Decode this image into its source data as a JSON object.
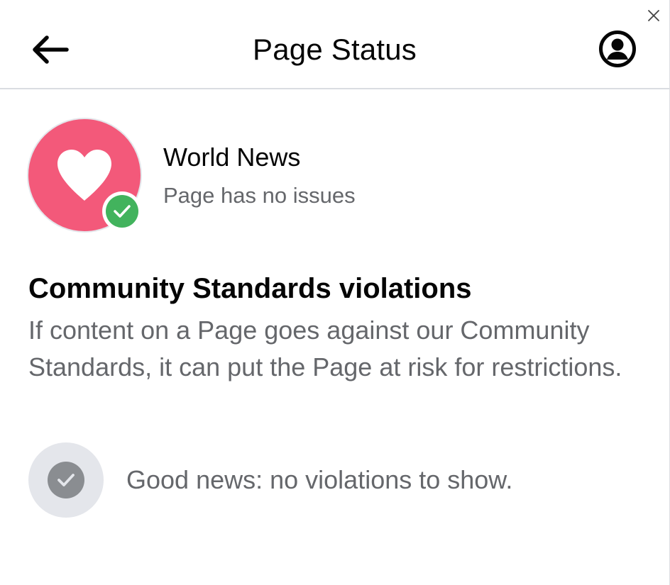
{
  "window": {
    "close_icon": "close-icon"
  },
  "header": {
    "title": "Page Status",
    "back_icon": "arrow-left-icon",
    "profile_icon": "user-circle-icon"
  },
  "page": {
    "name": "World News",
    "status": "Page has no issues",
    "avatar_icon": "heart-icon",
    "avatar_color": "#f3597a",
    "badge_icon": "checkmark-icon",
    "badge_color": "#42b35d"
  },
  "violations": {
    "title": "Community Standards violations",
    "description": "If content on a Page goes against our Community Standards, it can put the Page at risk for restrictions.",
    "empty_icon": "checkmark-circle-icon",
    "empty_message": "Good news: no violations to show."
  }
}
